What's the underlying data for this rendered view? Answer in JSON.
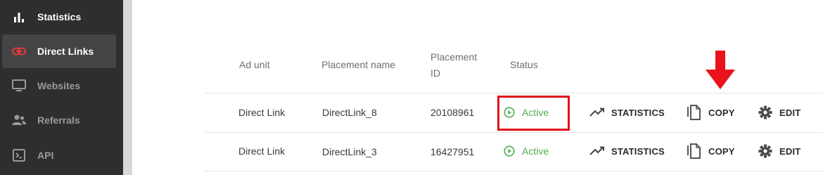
{
  "sidebar": {
    "items": [
      {
        "label": "Statistics",
        "icon": "bar-chart-icon"
      },
      {
        "label": "Direct Links",
        "icon": "link-icon"
      },
      {
        "label": "Websites",
        "icon": "monitor-icon"
      },
      {
        "label": "Referrals",
        "icon": "users-icon"
      },
      {
        "label": "API",
        "icon": "terminal-icon"
      }
    ]
  },
  "table": {
    "headers": {
      "ad_unit": "Ad unit",
      "placement_name": "Placement name",
      "placement_id_line1": "Placement",
      "placement_id_line2": "ID",
      "status": "Status"
    },
    "rows": [
      {
        "ad_unit": "Direct Link",
        "placement_name": "DirectLink_8",
        "placement_id": "20108961",
        "status": "Active"
      },
      {
        "ad_unit": "Direct Link",
        "placement_name": "DirectLink_3",
        "placement_id": "16427951",
        "status": "Active"
      }
    ],
    "actions": {
      "statistics": "STATISTICS",
      "copy": "COPY",
      "edit": "EDIT"
    }
  },
  "colors": {
    "active_green": "#4caf50",
    "accent_red": "#e0101a",
    "link_red": "#e8383e"
  }
}
